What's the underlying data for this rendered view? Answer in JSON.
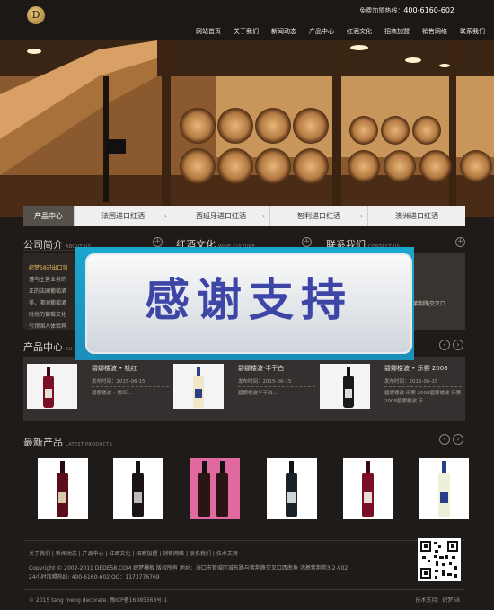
{
  "header": {
    "logo_letter": "D",
    "hotline_label": "免费加盟热线：",
    "hotline_number": "400-6160-602",
    "nav": [
      "网站首页",
      "关于我们",
      "新闻动态",
      "产品中心",
      "红酒文化",
      "招商加盟",
      "销售网络",
      "联系我们"
    ]
  },
  "tabs": {
    "active": "产品中心",
    "items": [
      "法国进口红酒",
      "西班牙进口红酒",
      "智利进口红酒",
      "澳洲进口红酒"
    ]
  },
  "sections": {
    "about": {
      "title": "公司简介",
      "sub": "ABOUT US"
    },
    "culture": {
      "title": "红酒文化",
      "sub": "WINE CULTURE"
    },
    "contact": {
      "title": "联系我们",
      "sub": "CONTACT US"
    },
    "products": {
      "title": "产品中心",
      "sub": "SU"
    },
    "new_products": {
      "title": "最新产品",
      "sub": "LATEST PRODUCTS"
    }
  },
  "about_text": [
    "织梦58进出口贸",
    "遵乌主营业务的",
    "正的法国葡萄酒",
    "美、澳洲葡萄酒",
    "时尚的葡萄文化",
    "引领国人体验异"
  ],
  "contact_text": "与紫荆路交叉口",
  "overlay_text": "感谢支持",
  "products": [
    {
      "name": "碧娜楼波 • 桃红",
      "date": "发布时间：2015-06-15",
      "desc": "碧娜楼波 • 桃红..."
    },
    {
      "name": "碧娜楼波·半干白",
      "date": "发布时间：2015-06-15",
      "desc": "碧娜楼波半干白..."
    },
    {
      "name": "碧娜楼波 • 乐赛 2008",
      "date": "发布时间：2015-06-15",
      "desc": "碧娜楼波 乐赛 2008碧娜楼波 乐赛 2008碧娜楼波 乐..."
    }
  ],
  "footer": {
    "links": "关于我们 | 新闻动态 | 产品中心 | 红酒文化 | 招商加盟 | 销售网络 | 联系我们 | 技术支持",
    "copyright": "Copyright © 2002-2011 DEDE58.COM 织梦模板 版权所有 地址：海口市管城区城东路与紫荆路交叉口西南角 鸿基紫荆苑3-2-902",
    "hotline": "24小时加盟热线: 400-6160-602 QQ：1173776769",
    "icp": "© 2015 tang meng decorate. 豫ICP备16985368号-1",
    "support": "技术支持：织梦58"
  },
  "colors": {
    "background": "#1f1b19",
    "accent_gold": "#e9c05a",
    "overlay_blue": "#1aa7cf",
    "overlay_text": "#3d45a6"
  }
}
